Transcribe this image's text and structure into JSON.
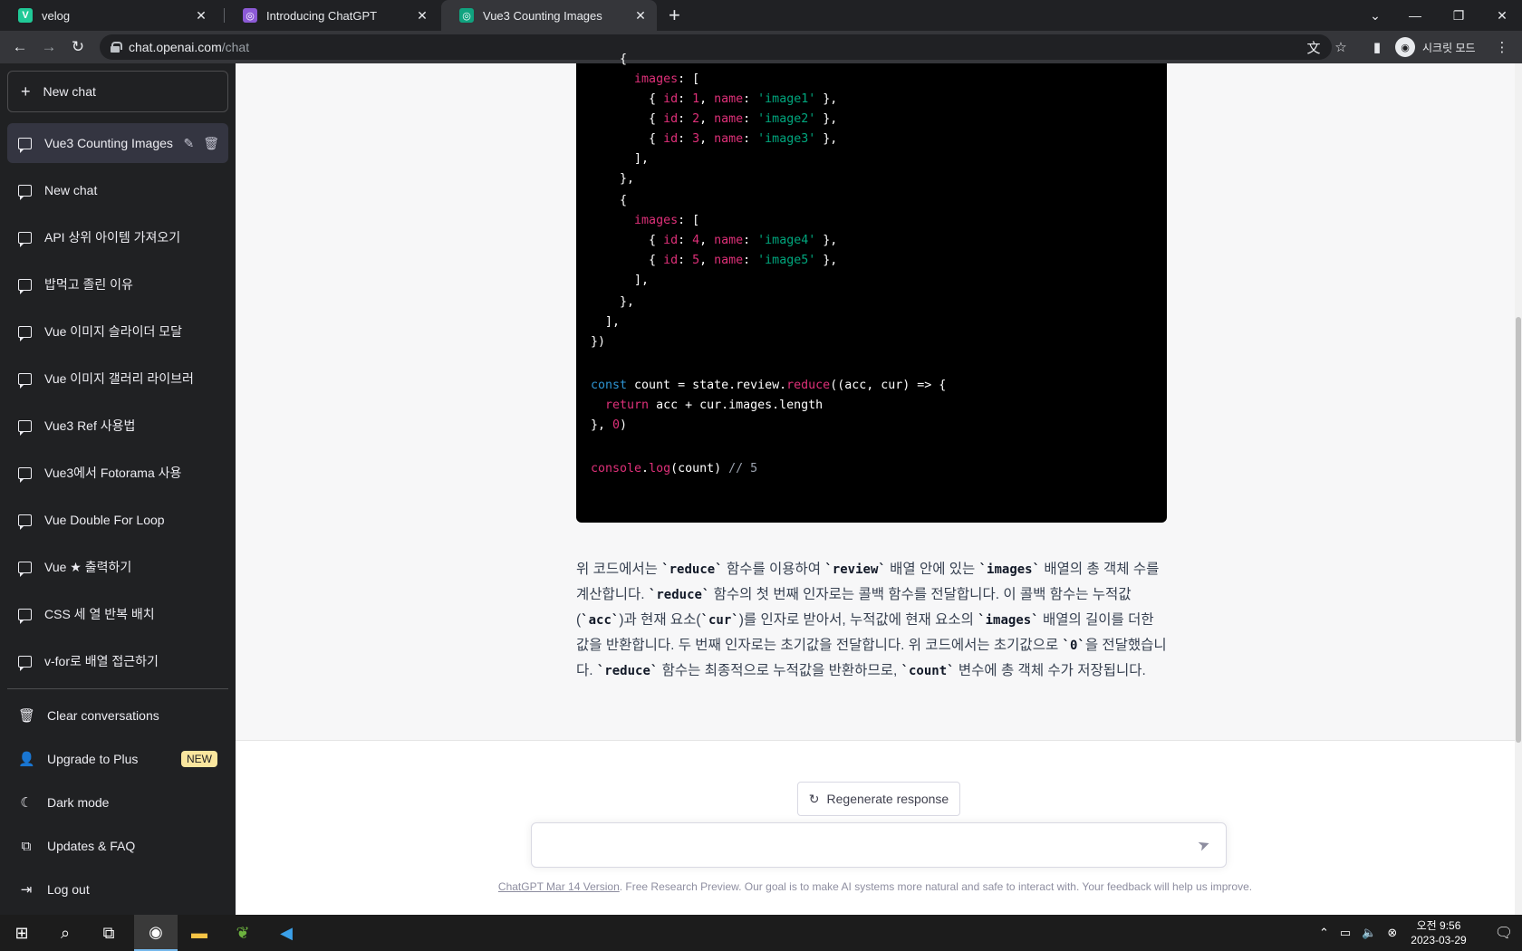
{
  "browser": {
    "tabs": [
      {
        "title": "velog",
        "favicon": "V",
        "favicon_color": "#20c997"
      },
      {
        "title": "Introducing ChatGPT",
        "favicon": "◎",
        "favicon_color": "#8c5ad6"
      },
      {
        "title": "Vue3 Counting Images",
        "favicon": "◎",
        "favicon_color": "#10a37f"
      }
    ],
    "close_glyph": "✕",
    "url_host": "chat.openai.com",
    "url_path": "/chat",
    "profile_label": "시크릿 모드"
  },
  "sidebar": {
    "new_chat": "New chat",
    "conversations": [
      "Vue3 Counting Images",
      "New chat",
      "API 상위 아이템 가져오기",
      "밥먹고 졸린 이유",
      "Vue 이미지 슬라이더 모달",
      "Vue 이미지 갤러리 라이브러",
      "Vue3 Ref 사용법",
      "Vue3에서 Fotorama 사용",
      "Vue Double For Loop",
      "Vue ★ 출력하기",
      "CSS 세 열 반복 배치",
      "v-for로 배열 접근하기"
    ],
    "bottom": {
      "clear": "Clear conversations",
      "upgrade": "Upgrade to Plus",
      "upgrade_badge": "NEW",
      "dark_mode": "Dark mode",
      "updates": "Updates & FAQ",
      "logout": "Log out"
    }
  },
  "code_lines": [
    [
      [
        "    {",
        "t"
      ]
    ],
    [
      [
        "      ",
        "t"
      ],
      [
        "images",
        "p"
      ],
      [
        ": [",
        "t"
      ]
    ],
    [
      [
        "        { ",
        "t"
      ],
      [
        "id",
        "p"
      ],
      [
        ": ",
        "t"
      ],
      [
        "1",
        "n"
      ],
      [
        ", ",
        "t"
      ],
      [
        "name",
        "p"
      ],
      [
        ": ",
        "t"
      ],
      [
        "'image1'",
        "s"
      ],
      [
        " },",
        "t"
      ]
    ],
    [
      [
        "        { ",
        "t"
      ],
      [
        "id",
        "p"
      ],
      [
        ": ",
        "t"
      ],
      [
        "2",
        "n"
      ],
      [
        ", ",
        "t"
      ],
      [
        "name",
        "p"
      ],
      [
        ": ",
        "t"
      ],
      [
        "'image2'",
        "s"
      ],
      [
        " },",
        "t"
      ]
    ],
    [
      [
        "        { ",
        "t"
      ],
      [
        "id",
        "p"
      ],
      [
        ": ",
        "t"
      ],
      [
        "3",
        "n"
      ],
      [
        ", ",
        "t"
      ],
      [
        "name",
        "p"
      ],
      [
        ": ",
        "t"
      ],
      [
        "'image3'",
        "s"
      ],
      [
        " },",
        "t"
      ]
    ],
    [
      [
        "      ],",
        "t"
      ]
    ],
    [
      [
        "    },",
        "t"
      ]
    ],
    [
      [
        "    {",
        "t"
      ]
    ],
    [
      [
        "      ",
        "t"
      ],
      [
        "images",
        "p"
      ],
      [
        ": [",
        "t"
      ]
    ],
    [
      [
        "        { ",
        "t"
      ],
      [
        "id",
        "p"
      ],
      [
        ": ",
        "t"
      ],
      [
        "4",
        "n"
      ],
      [
        ", ",
        "t"
      ],
      [
        "name",
        "p"
      ],
      [
        ": ",
        "t"
      ],
      [
        "'image4'",
        "s"
      ],
      [
        " },",
        "t"
      ]
    ],
    [
      [
        "        { ",
        "t"
      ],
      [
        "id",
        "p"
      ],
      [
        ": ",
        "t"
      ],
      [
        "5",
        "n"
      ],
      [
        ", ",
        "t"
      ],
      [
        "name",
        "p"
      ],
      [
        ": ",
        "t"
      ],
      [
        "'image5'",
        "s"
      ],
      [
        " },",
        "t"
      ]
    ],
    [
      [
        "      ],",
        "t"
      ]
    ],
    [
      [
        "    },",
        "t"
      ]
    ],
    [
      [
        "  ],",
        "t"
      ]
    ],
    [
      [
        "})",
        "t"
      ]
    ],
    [
      [
        "",
        "t"
      ]
    ],
    [
      [
        "const",
        "k"
      ],
      [
        " count = state.review.",
        "t"
      ],
      [
        "reduce",
        "p"
      ],
      [
        "((acc, cur) => {",
        "t"
      ]
    ],
    [
      [
        "  ",
        "t"
      ],
      [
        "return",
        "p"
      ],
      [
        " acc + cur.images.length",
        "t"
      ]
    ],
    [
      [
        "}, ",
        "t"
      ],
      [
        "0",
        "n"
      ],
      [
        ")",
        "t"
      ]
    ],
    [
      [
        "",
        "t"
      ]
    ],
    [
      [
        "console",
        "p"
      ],
      [
        ".",
        "t"
      ],
      [
        "log",
        "p"
      ],
      [
        "(count) ",
        "t"
      ],
      [
        "// 5",
        "c"
      ]
    ]
  ],
  "answer_segments": [
    [
      "위 코드에서는 ",
      "t"
    ],
    [
      "`reduce`",
      "c"
    ],
    [
      " 함수를 이용하여 ",
      "t"
    ],
    [
      "`review`",
      "c"
    ],
    [
      " 배열 안에 있는 ",
      "t"
    ],
    [
      "`images`",
      "c"
    ],
    [
      " 배열의 총 객체 수를 계산합니다. ",
      "t"
    ],
    [
      "`reduce`",
      "c"
    ],
    [
      " 함수의 첫 번째 인자로는 콜백 함수를 전달합니다. 이 콜백 함수는 누적값(",
      "t"
    ],
    [
      "`acc`",
      "c"
    ],
    [
      ")과 현재 요소(",
      "t"
    ],
    [
      "`cur`",
      "c"
    ],
    [
      ")를 인자로 받아서, 누적값에 현재 요소의 ",
      "t"
    ],
    [
      "`images`",
      "c"
    ],
    [
      " 배열의 길이를 더한 값을 반환합니다. 두 번째 인자로는 초기값을 전달합니다. 위 코드에서는 초기값으로 ",
      "t"
    ],
    [
      "`0`",
      "c"
    ],
    [
      "을 전달했습니다. ",
      "t"
    ],
    [
      "`reduce`",
      "c"
    ],
    [
      " 함수는 최종적으로 누적값을 반환하므로, ",
      "t"
    ],
    [
      "`count`",
      "c"
    ],
    [
      " 변수에 총 객체 수가 저장됩니다.",
      "t"
    ]
  ],
  "composer": {
    "regenerate": "Regenerate response",
    "input_value": "",
    "footer_link": "ChatGPT Mar 14 Version",
    "footer_text": ". Free Research Preview. Our goal is to make AI systems more natural and safe to interact with. Your feedback will help us improve."
  },
  "taskbar": {
    "time": "오전 9:56",
    "date": "2023-03-29"
  },
  "colors": {
    "sidebar_bg": "#202123",
    "code_bg": "#000000",
    "code_keyword": "#2e95d3",
    "code_property": "#df3079",
    "code_string": "#00a67d",
    "new_badge": "#fae69e"
  }
}
